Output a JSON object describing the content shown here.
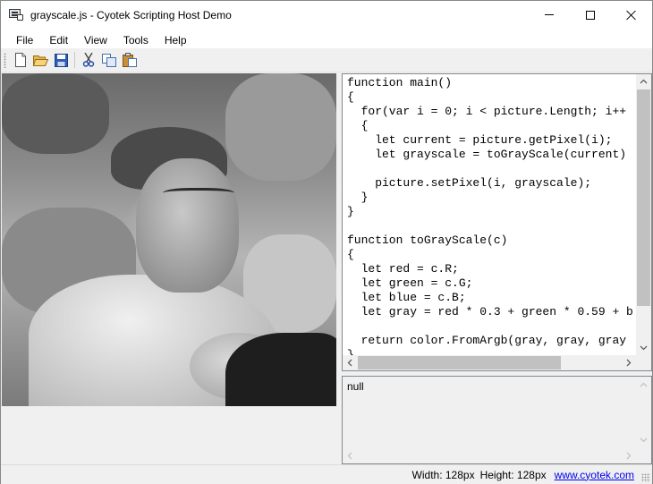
{
  "window": {
    "title": "grayscale.js - Cyotek Scripting Host Demo"
  },
  "menu": {
    "items": [
      "File",
      "Edit",
      "View",
      "Tools",
      "Help"
    ]
  },
  "toolbar": {
    "buttons": [
      "new-file-icon",
      "open-folder-icon",
      "save-disk-icon",
      "cut-scissors-icon",
      "copy-icon",
      "paste-icon"
    ]
  },
  "editor": {
    "code": "function main()\n{\n  for(var i = 0; i < picture.Length; i++\n  {\n    let current = picture.getPixel(i);\n    let grayscale = toGrayScale(current)\n\n    picture.setPixel(i, grayscale);\n  }\n}\n\nfunction toGrayScale(c)\n{\n  let red = c.R;\n  let green = c.G;\n  let blue = c.B;\n  let gray = red * 0.3 + green * 0.59 + b\n\n  return color.FromArgb(gray, gray, gray\n}"
  },
  "output": {
    "text": "null"
  },
  "status": {
    "width": "Width: 128px",
    "height": "Height: 128px",
    "link": "www.cyotek.com"
  }
}
